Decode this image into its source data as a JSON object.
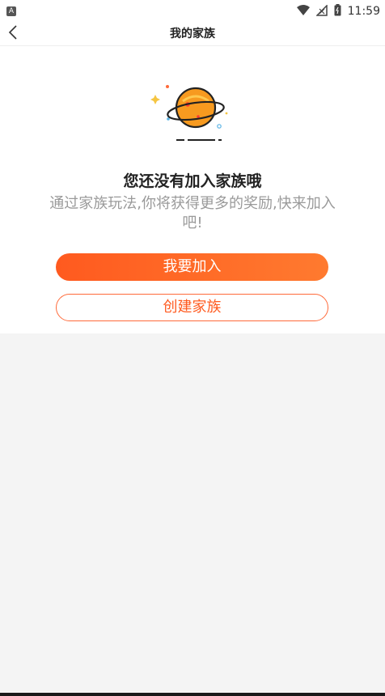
{
  "status_bar": {
    "app_badge": "A",
    "time": "11:59",
    "icons": [
      "wifi-icon",
      "signal-icon",
      "battery-icon"
    ]
  },
  "header": {
    "title": "我的家族",
    "back_icon": "chevron-left-icon"
  },
  "empty_state": {
    "illustration": "planet-icon",
    "title": "您还没有加入家族哦",
    "description": "通过家族玩法,你将获得更多的奖励,快来加入吧!"
  },
  "actions": {
    "join_label": "我要加入",
    "create_label": "创建家族"
  },
  "colors": {
    "accent": "#ff5a1f",
    "accent_light": "#ff7a2f",
    "background": "#f4f4f4",
    "title_text": "#222222",
    "desc_text": "#9a9a9a"
  }
}
